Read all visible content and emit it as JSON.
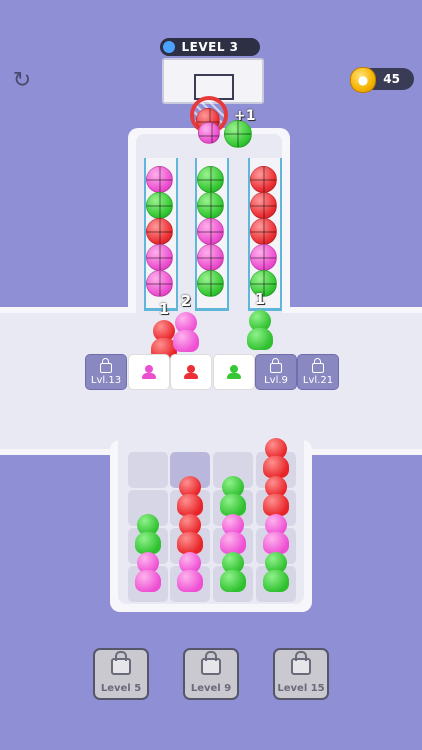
{
  "header": {
    "level_label": "LEVEL 3",
    "coins": "45"
  },
  "hoop": {
    "score_popup": "+1"
  },
  "colors": {
    "pink": "#ec4fcf",
    "green": "#35c834",
    "red": "#ec2f34",
    "background": "#8f8fd6"
  },
  "icons": {
    "refresh": "refresh-icon",
    "coin": "coin-icon",
    "lock": "lock-icon"
  },
  "tubes": [
    {
      "balls": [
        "pink",
        "green",
        "red",
        "pink",
        "pink"
      ]
    },
    {
      "balls": [
        "green",
        "green",
        "pink",
        "pink",
        "green"
      ]
    },
    {
      "balls": [
        "red",
        "red",
        "red",
        "pink",
        "green"
      ]
    }
  ],
  "queue_people": [
    {
      "color": "red",
      "count": "1"
    },
    {
      "color": "pink",
      "count": "2"
    },
    {
      "color": "green",
      "count": "1"
    }
  ],
  "slots": [
    {
      "type": "locked",
      "label": "Lvl.13"
    },
    {
      "type": "open",
      "color": "pink"
    },
    {
      "type": "open",
      "color": "red"
    },
    {
      "type": "open",
      "color": "green"
    },
    {
      "type": "locked",
      "label": "Lvl.9"
    },
    {
      "type": "locked",
      "label": "Lvl.21"
    }
  ],
  "crowd_grid": [
    [
      "",
      "",
      "",
      "red"
    ],
    [
      "",
      "red",
      "green",
      "red"
    ],
    [
      "green",
      "red",
      "pink",
      "pink"
    ],
    [
      "pink",
      "pink",
      "green",
      "green"
    ]
  ],
  "level_buttons": [
    {
      "label": "Level 5"
    },
    {
      "label": "Level 9"
    },
    {
      "label": "Level 15"
    }
  ]
}
